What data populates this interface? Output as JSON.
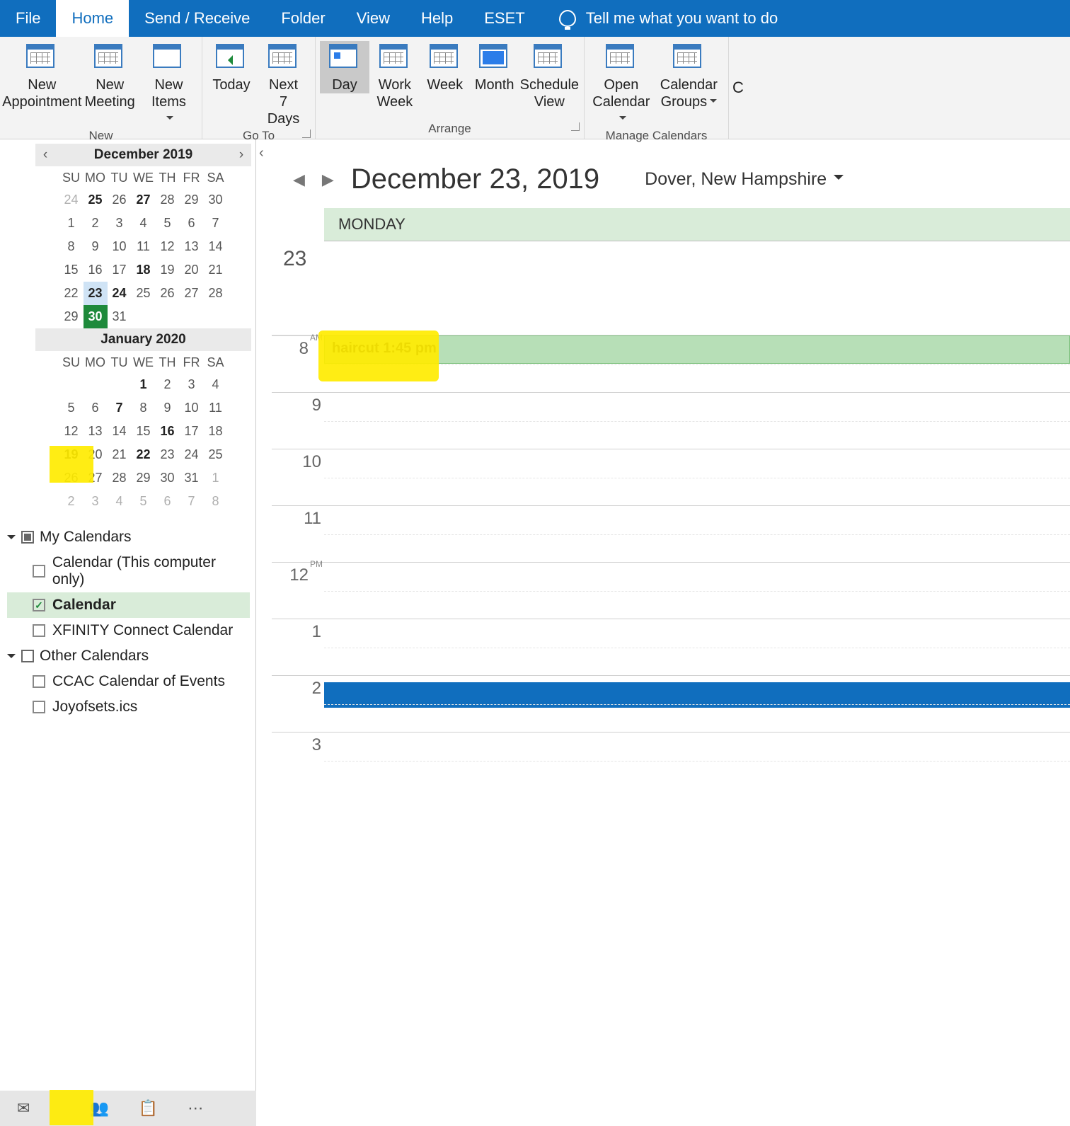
{
  "tabs": {
    "file": "File",
    "home": "Home",
    "sendReceive": "Send / Receive",
    "folder": "Folder",
    "view": "View",
    "help": "Help",
    "eset": "ESET",
    "tellme": "Tell me what you want to do",
    "active": "home"
  },
  "ribbon": {
    "groups": {
      "new": {
        "label": "New",
        "newAppointment": "New Appointment",
        "newMeeting": "New Meeting",
        "newItems": "New Items"
      },
      "goto": {
        "label": "Go To",
        "today": "Today",
        "next7": "Next 7 Days"
      },
      "arrange": {
        "label": "Arrange",
        "day": "Day",
        "workWeek": "Work Week",
        "week": "Week",
        "month": "Month",
        "scheduleView": "Schedule View",
        "active": "day"
      },
      "manage": {
        "label": "Manage Calendars",
        "openCalendar": "Open Calendar",
        "calendarGroups": "Calendar Groups"
      }
    }
  },
  "dateNavigator": {
    "months": [
      {
        "title": "December 2019",
        "dow": [
          "SU",
          "MO",
          "TU",
          "WE",
          "TH",
          "FR",
          "SA"
        ],
        "weeks": [
          [
            {
              "d": "24",
              "dim": true
            },
            {
              "d": "25",
              "bold": true
            },
            {
              "d": "26"
            },
            {
              "d": "27",
              "bold": true
            },
            {
              "d": "28"
            },
            {
              "d": "29"
            },
            {
              "d": "30"
            }
          ],
          [
            {
              "d": "1"
            },
            {
              "d": "2"
            },
            {
              "d": "3"
            },
            {
              "d": "4"
            },
            {
              "d": "5"
            },
            {
              "d": "6"
            },
            {
              "d": "7"
            }
          ],
          [
            {
              "d": "8"
            },
            {
              "d": "9"
            },
            {
              "d": "10"
            },
            {
              "d": "11"
            },
            {
              "d": "12"
            },
            {
              "d": "13"
            },
            {
              "d": "14"
            }
          ],
          [
            {
              "d": "15"
            },
            {
              "d": "16"
            },
            {
              "d": "17"
            },
            {
              "d": "18",
              "bold": true
            },
            {
              "d": "19"
            },
            {
              "d": "20"
            },
            {
              "d": "21"
            }
          ],
          [
            {
              "d": "22"
            },
            {
              "d": "23",
              "sel": true,
              "bold": true
            },
            {
              "d": "24",
              "bold": true
            },
            {
              "d": "25"
            },
            {
              "d": "26"
            },
            {
              "d": "27"
            },
            {
              "d": "28"
            }
          ],
          [
            {
              "d": "29"
            },
            {
              "d": "30",
              "today": true
            },
            {
              "d": "31"
            },
            {
              "d": ""
            },
            {
              "d": ""
            },
            {
              "d": ""
            },
            {
              "d": ""
            }
          ]
        ]
      },
      {
        "title": "January 2020",
        "dow": [
          "SU",
          "MO",
          "TU",
          "WE",
          "TH",
          "FR",
          "SA"
        ],
        "weeks": [
          [
            {
              "d": ""
            },
            {
              "d": ""
            },
            {
              "d": ""
            },
            {
              "d": "1",
              "bold": true
            },
            {
              "d": "2"
            },
            {
              "d": "3"
            },
            {
              "d": "4"
            }
          ],
          [
            {
              "d": "5"
            },
            {
              "d": "6"
            },
            {
              "d": "7",
              "bold": true
            },
            {
              "d": "8"
            },
            {
              "d": "9"
            },
            {
              "d": "10"
            },
            {
              "d": "11"
            }
          ],
          [
            {
              "d": "12"
            },
            {
              "d": "13"
            },
            {
              "d": "14"
            },
            {
              "d": "15"
            },
            {
              "d": "16",
              "bold": true
            },
            {
              "d": "17"
            },
            {
              "d": "18"
            }
          ],
          [
            {
              "d": "19",
              "bold": true
            },
            {
              "d": "20"
            },
            {
              "d": "21"
            },
            {
              "d": "22",
              "bold": true
            },
            {
              "d": "23"
            },
            {
              "d": "24"
            },
            {
              "d": "25"
            }
          ],
          [
            {
              "d": "26"
            },
            {
              "d": "27"
            },
            {
              "d": "28"
            },
            {
              "d": "29"
            },
            {
              "d": "30"
            },
            {
              "d": "31"
            },
            {
              "d": "1",
              "dim": true
            }
          ],
          [
            {
              "d": "2",
              "dim": true
            },
            {
              "d": "3",
              "dim": true
            },
            {
              "d": "4",
              "dim": true
            },
            {
              "d": "5",
              "dim": true
            },
            {
              "d": "6",
              "dim": true
            },
            {
              "d": "7",
              "dim": true
            },
            {
              "d": "8",
              "dim": true
            }
          ]
        ]
      }
    ]
  },
  "calendarTree": {
    "group1": {
      "label": "My Calendars",
      "items": [
        {
          "label": "Calendar (This computer only)",
          "checked": false
        },
        {
          "label": "Calendar",
          "checked": true,
          "active": true
        },
        {
          "label": "XFINITY Connect Calendar",
          "checked": false
        }
      ]
    },
    "group2": {
      "label": "Other Calendars",
      "items": [
        {
          "label": "CCAC Calendar of Events",
          "checked": false
        },
        {
          "label": "Joyofsets.ics",
          "checked": false
        }
      ]
    }
  },
  "content": {
    "dateTitle": "December 23, 2019",
    "location": "Dover, New Hampshire",
    "dayHeader": "MONDAY",
    "dayNumber": "23",
    "appointment": {
      "title": "haircut 1:45 pm",
      "hour": 8
    },
    "hours": [
      {
        "h": "8",
        "suffix": "AM"
      },
      {
        "h": "9",
        "suffix": ""
      },
      {
        "h": "10",
        "suffix": ""
      },
      {
        "h": "11",
        "suffix": ""
      },
      {
        "h": "12",
        "suffix": "PM"
      },
      {
        "h": "1",
        "suffix": ""
      },
      {
        "h": "2",
        "suffix": ""
      },
      {
        "h": "3",
        "suffix": ""
      }
    ]
  }
}
